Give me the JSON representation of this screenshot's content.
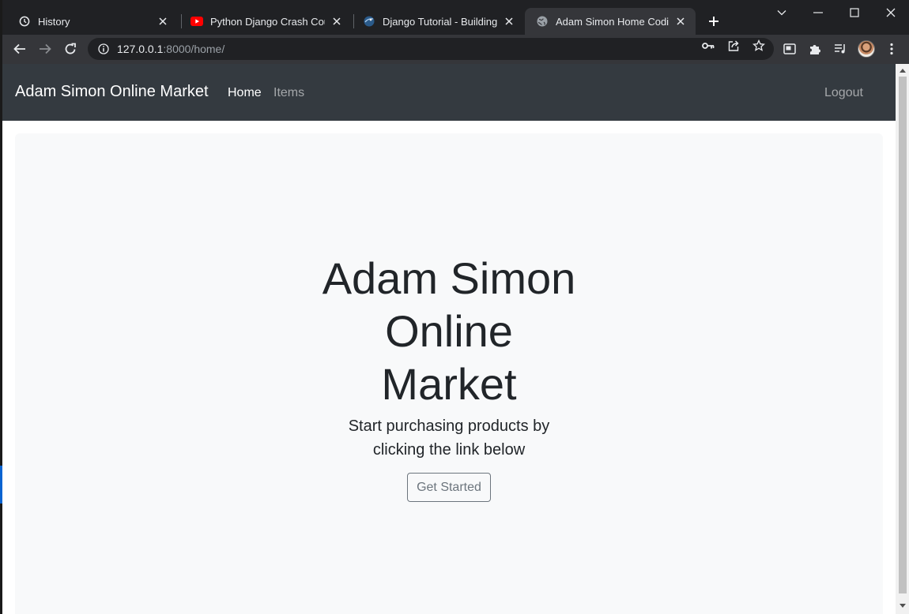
{
  "browser": {
    "tabs": [
      {
        "title": "History",
        "icon": "history-icon",
        "active": false
      },
      {
        "title": "Python Django Crash Course",
        "icon": "youtube-icon",
        "active": false
      },
      {
        "title": "Django Tutorial - Building a M",
        "icon": "site-favicon-icon",
        "active": false
      },
      {
        "title": "Adam Simon Home Coding",
        "icon": "globe-icon",
        "active": true
      }
    ],
    "url_host": "127.0.0.1",
    "url_rest": ":8000/home/"
  },
  "page": {
    "navbar": {
      "brand": "Adam Simon Online Market",
      "links": [
        {
          "label": "Home",
          "active": true
        },
        {
          "label": "Items",
          "active": false
        }
      ],
      "logout": "Logout"
    },
    "hero": {
      "title_lines": [
        "Adam Simon",
        "Online",
        "Market"
      ],
      "lead_lines": [
        "Start purchasing products by",
        "clicking the link below"
      ],
      "button": "Get Started"
    }
  },
  "colors": {
    "navbar_bg": "#343a40",
    "jumbotron_bg": "#f8f9fa",
    "chrome_dark": "#202124",
    "chrome_toolbar": "#35363a",
    "youtube_red": "#ff0000"
  }
}
